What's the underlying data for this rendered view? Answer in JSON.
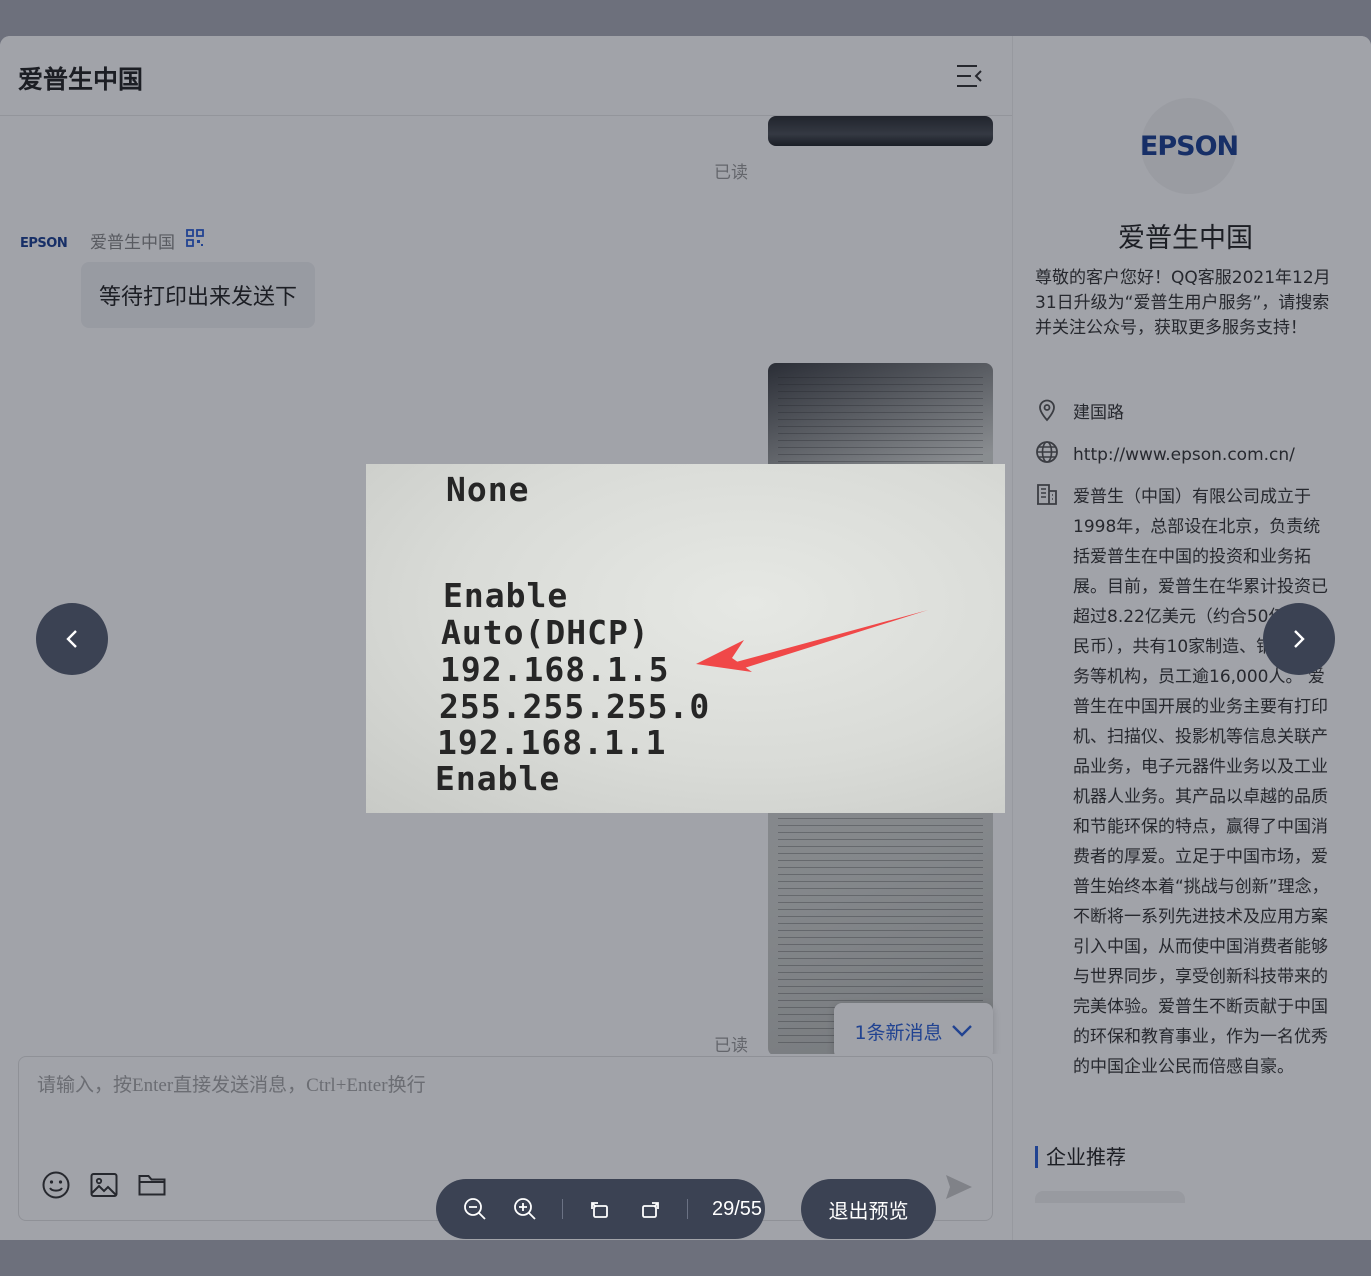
{
  "chat": {
    "title": "爱普生中国",
    "read_label": "已读",
    "sender": {
      "logo_text": "EPSON",
      "name": "爱普生中国"
    },
    "message": "等待打印出来发送下",
    "new_messages": "1条新消息",
    "input_placeholder": "请输入，按Enter直接发送消息，Ctrl+Enter换行"
  },
  "profile": {
    "logo_text": "EPSON",
    "name": "爱普生中国",
    "intro": "尊敬的客户您好！QQ客服2021年12月31日升级为“爱普生用户服务”，请搜索并关注公众号，获取更多服务支持！",
    "address": "建国路",
    "website": "http://www.epson.com.cn/",
    "description": "爱普生（中国）有限公司成立于1998年，总部设在北京，负责统括爱普生在中国的投资和业务拓展。目前，爱普生在华累计投资已超过8.22亿美元（约合50亿元人民币），共有10家制造、销售及服务等机构，员工逾16,000人。 爱普生在中国开展的业务主要有打印机、扫描仪、投影机等信息关联产品业务，电子元器件业务以及工业机器人业务。其产品以卓越的品质和节能环保的特点，赢得了中国消费者的厚爱。立足于中国市场，爱普生始终本着“挑战与创新”理念，不断将一系列先进技术及应用方案引入中国，从而使中国消费者能够与世界同步，享受创新科技带来的完美体验。爱普生不断贡献于中国的环保和教育事业，作为一名优秀的中国企业公民而倍感自豪。",
    "recommend_title": "企业推荐"
  },
  "preview": {
    "lines": [
      "None",
      "Enable",
      "Auto(DHCP)",
      "192.168.1.5",
      "255.255.255.0",
      "192.168.1.1",
      "Enable"
    ],
    "page_counter": "29/55",
    "exit_label": "退出预览",
    "accent_color": "#f04848"
  },
  "colors": {
    "brand_blue": "#1a3f91",
    "link_blue": "#2b5fd8",
    "control_bg": "#3b4253"
  }
}
